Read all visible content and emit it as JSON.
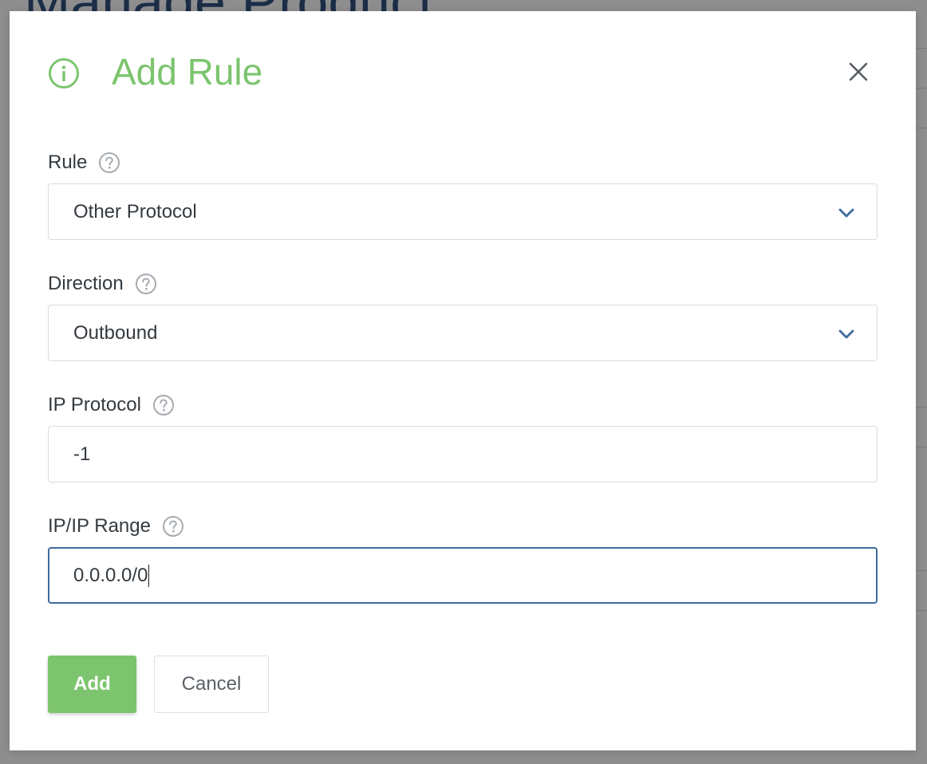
{
  "background": {
    "title": "Manage Product"
  },
  "modal": {
    "title": "Add Rule",
    "title_color": "#7cc46e",
    "info_icon": "info-circle-icon",
    "close_icon": "close-icon"
  },
  "form": {
    "rule": {
      "label": "Rule",
      "value": "Other Protocol"
    },
    "direction": {
      "label": "Direction",
      "value": "Outbound"
    },
    "ip_protocol": {
      "label": "IP Protocol",
      "value": "-1"
    },
    "ip_range": {
      "label": "IP/IP Range",
      "value": "0.0.0.0/0"
    }
  },
  "buttons": {
    "add_label": "Add",
    "cancel_label": "Cancel",
    "accent_color": "#7cc46e"
  }
}
